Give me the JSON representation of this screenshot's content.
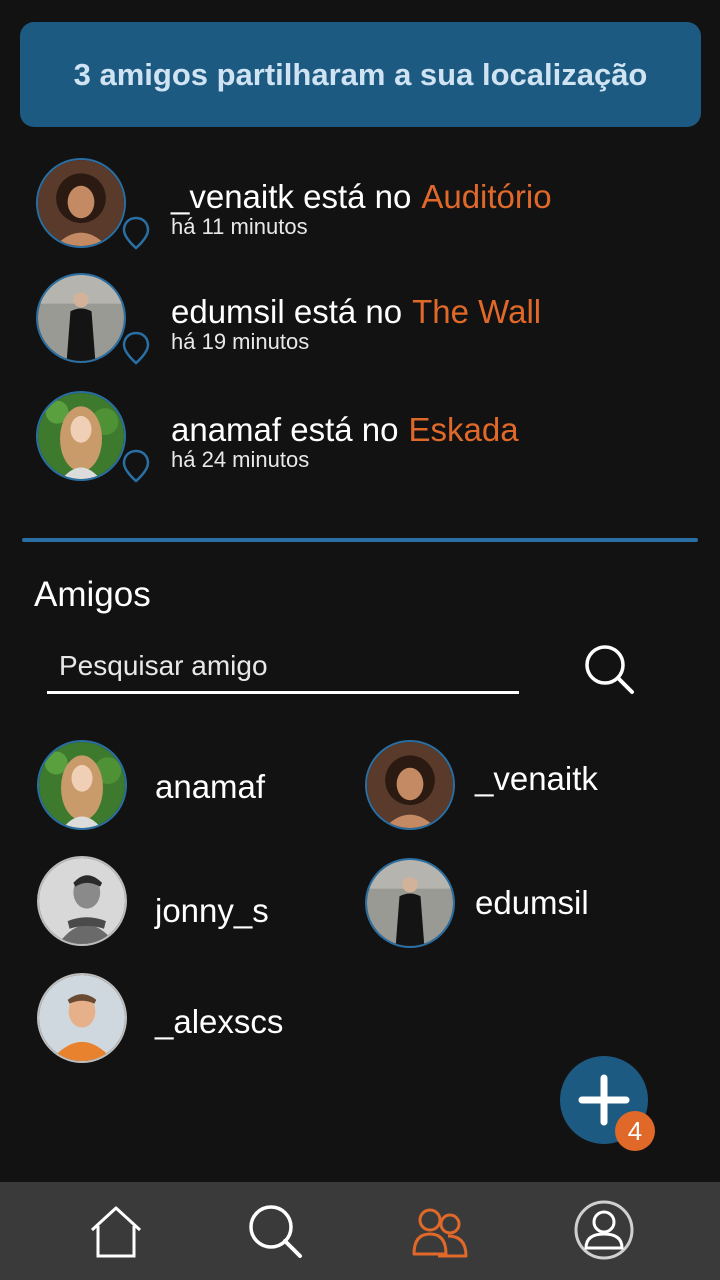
{
  "banner": {
    "text": "3 amigos partilharam a sua localização"
  },
  "location_updates": [
    {
      "user": "_venaitk",
      "verb": "está no",
      "place": "Auditório",
      "time": "há 11 minutos"
    },
    {
      "user": "edumsil",
      "verb": "está no",
      "place": "The Wall",
      "time": "há 19 minutos"
    },
    {
      "user": "anamaf",
      "verb": "está no",
      "place": "Eskada",
      "time": "há 24 minutos"
    }
  ],
  "friends_section": {
    "title": "Amigos",
    "search_placeholder": "Pesquisar amigo",
    "friends": [
      {
        "name": "anamaf"
      },
      {
        "name": "_venaitk"
      },
      {
        "name": "jonny_s"
      },
      {
        "name": "edumsil"
      },
      {
        "name": "_alexscs"
      }
    ]
  },
  "fab": {
    "icon": "plus-icon",
    "badge": "4"
  },
  "nav": {
    "items": [
      {
        "icon": "home-icon"
      },
      {
        "icon": "search-icon"
      },
      {
        "icon": "friends-icon",
        "active": true
      },
      {
        "icon": "profile-icon"
      }
    ]
  },
  "colors": {
    "accent": "#e0692a",
    "primary": "#1d5a82",
    "background": "#121212",
    "navbar": "#3a3a3a"
  }
}
